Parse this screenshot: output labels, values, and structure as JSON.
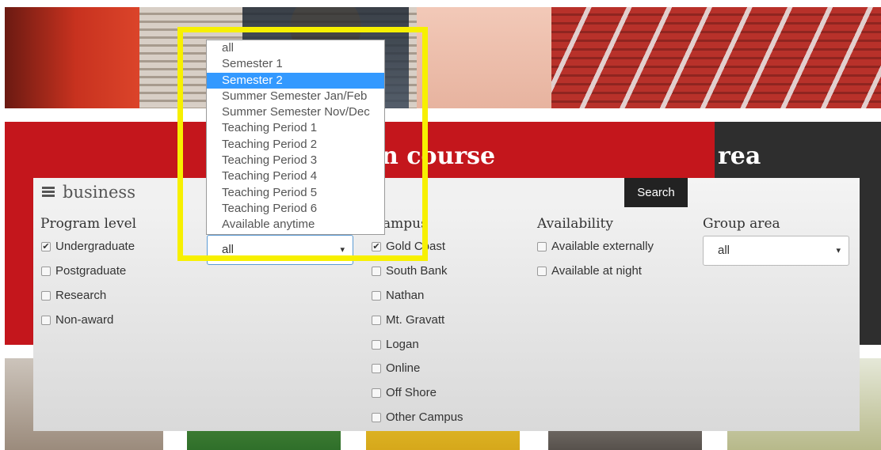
{
  "header": {
    "title_left": "n course",
    "title_right": "rea"
  },
  "search": {
    "query": "business",
    "button": "Search"
  },
  "program_level": {
    "title": "Program level",
    "options": [
      {
        "label": "Undergraduate",
        "checked": true
      },
      {
        "label": "Postgraduate",
        "checked": false
      },
      {
        "label": "Research",
        "checked": false
      },
      {
        "label": "Non-award",
        "checked": false
      }
    ]
  },
  "study_period": {
    "selected": "all",
    "options": [
      "all",
      "Semester 1",
      "Semester 2",
      "Summer Semester Jan/Feb",
      "Summer Semester Nov/Dec",
      "Teaching Period 1",
      "Teaching Period 2",
      "Teaching Period 3",
      "Teaching Period 4",
      "Teaching Period 5",
      "Teaching Period 6",
      "Available anytime"
    ],
    "highlighted": "Semester 2"
  },
  "campus": {
    "title": "Campus",
    "options": [
      {
        "label": "Gold Coast",
        "checked": true
      },
      {
        "label": "South Bank",
        "checked": false
      },
      {
        "label": "Nathan",
        "checked": false
      },
      {
        "label": "Mt. Gravatt",
        "checked": false
      },
      {
        "label": "Logan",
        "checked": false
      },
      {
        "label": "Online",
        "checked": false
      },
      {
        "label": "Off Shore",
        "checked": false
      },
      {
        "label": "Other Campus",
        "checked": false
      }
    ]
  },
  "availability": {
    "title": "Availability",
    "options": [
      {
        "label": "Available externally",
        "checked": false
      },
      {
        "label": "Available at night",
        "checked": false
      }
    ]
  },
  "group_area": {
    "title": "Group area",
    "selected": "all"
  },
  "icons": {
    "menu": "hamburger-menu-icon",
    "check": "checkmark-icon",
    "caret": "caret-down-icon"
  },
  "colors": {
    "brand_red": "#c4161c",
    "dark_panel": "#2e2e2e",
    "highlight": "#f7f000",
    "option_selected": "#3399ff"
  },
  "glyphs": {
    "check": "✔",
    "caret": "▾"
  }
}
